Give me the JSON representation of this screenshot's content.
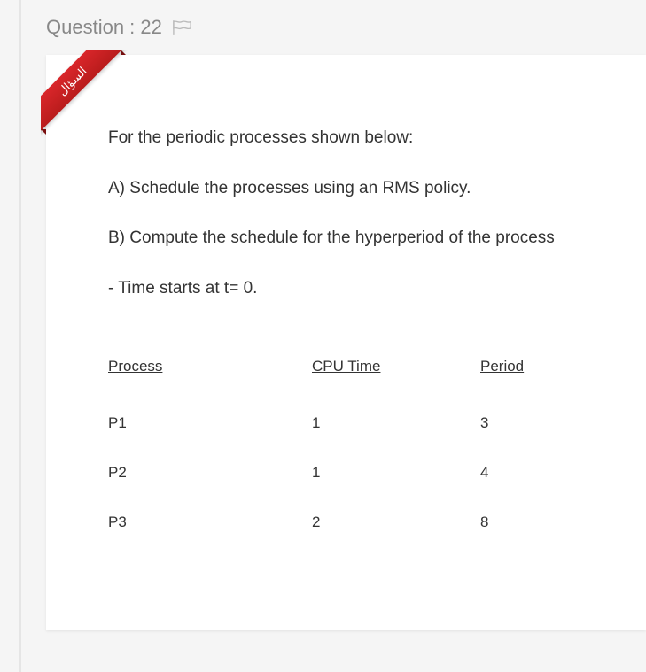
{
  "header": {
    "label": "Question : 22"
  },
  "ribbon": {
    "text": "السؤال"
  },
  "body": {
    "intro": "For the periodic processes shown below:",
    "partA": "A) Schedule the processes using an RMS policy.",
    "partB": "B) Compute the schedule for the hyperperiod of the process",
    "note": "- Time starts at t= 0."
  },
  "table": {
    "headers": {
      "process": "Process",
      "cpu": "CPU Time",
      "period": "Period"
    },
    "rows": [
      {
        "process": "P1",
        "cpu": "1",
        "period": "3"
      },
      {
        "process": "P2",
        "cpu": "1",
        "period": "4"
      },
      {
        "process": "P3",
        "cpu": "2",
        "period": "8"
      }
    ]
  }
}
